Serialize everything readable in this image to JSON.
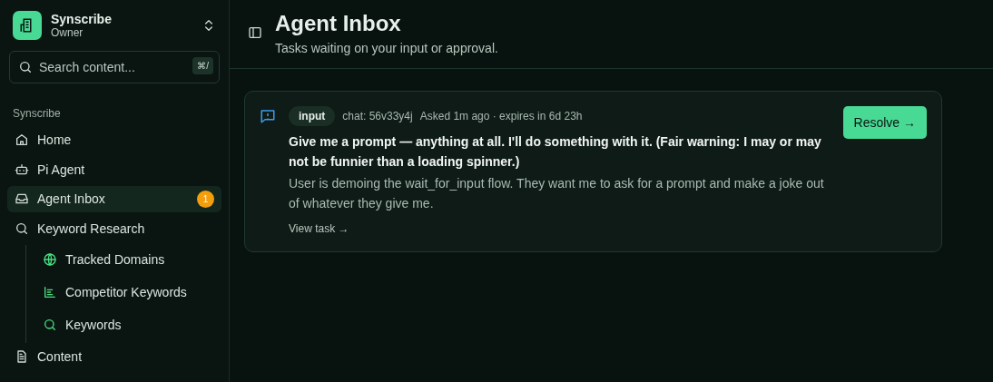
{
  "workspace": {
    "name": "Synscribe",
    "role": "Owner"
  },
  "search": {
    "placeholder": "Search content...",
    "shortcut": "⌘/"
  },
  "sidebar": {
    "section": "Synscribe",
    "items": [
      {
        "label": "Home",
        "selected": false
      },
      {
        "label": "Pi Agent",
        "selected": false
      },
      {
        "label": "Agent Inbox",
        "selected": true,
        "badge": "1"
      },
      {
        "label": "Keyword Research",
        "selected": false,
        "children": [
          {
            "label": "Tracked Domains",
            "selected": false
          },
          {
            "label": "Competitor Keywords",
            "selected": false
          },
          {
            "label": "Keywords",
            "selected": false
          }
        ]
      },
      {
        "label": "Content",
        "selected": false
      }
    ]
  },
  "header": {
    "title": "Agent Inbox",
    "subtitle": "Tasks waiting on your input or approval."
  },
  "tasks": [
    {
      "tag": "input",
      "chat": "chat: 56v33y4j",
      "meta": "Asked 1m ago · expires in 6d 23h",
      "question": "Give me a prompt — anything at all. I'll do something with it. (Fair warning: I may or may not be funnier than a loading spinner.)",
      "context": "User is demoing the wait_for_input flow. They want me to ask for a prompt and make a joke out of whatever they give me.",
      "link": "View task →",
      "action": "Resolve →"
    }
  ]
}
